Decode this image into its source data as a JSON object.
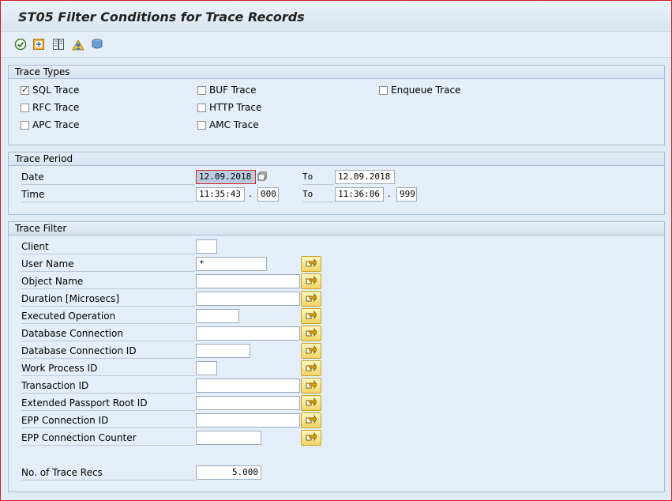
{
  "window": {
    "title": "ST05 Filter Conditions for Trace Records"
  },
  "toolbar": {
    "icons": [
      "execute-icon",
      "variant-icon",
      "list-icon",
      "users-icon",
      "database-icon"
    ]
  },
  "trace_types": {
    "header": "Trace Types",
    "items": [
      {
        "label": "SQL Trace",
        "checked": true
      },
      {
        "label": "BUF Trace",
        "checked": false
      },
      {
        "label": "Enqueue Trace",
        "checked": false
      },
      {
        "label": "RFC Trace",
        "checked": false
      },
      {
        "label": "HTTP Trace",
        "checked": false
      },
      {
        "label": "APC Trace",
        "checked": false
      },
      {
        "label": "AMC Trace",
        "checked": false
      }
    ]
  },
  "trace_period": {
    "header": "Trace Period",
    "date_label": "Date",
    "time_label": "Time",
    "to_label": "To",
    "date_from": "12.09.2018",
    "date_to": "12.09.2018",
    "time_from": "11:35:43",
    "time_from_ms": "000",
    "time_to": "11:36:06",
    "time_to_ms": "999",
    "separator": "."
  },
  "trace_filter": {
    "header": "Trace Filter",
    "fields": [
      {
        "label": "Client",
        "value": ""
      },
      {
        "label": "User Name",
        "value": "*"
      },
      {
        "label": "Object Name",
        "value": ""
      },
      {
        "label": "Duration [Microsecs]",
        "value": ""
      },
      {
        "label": "Executed Operation",
        "value": ""
      },
      {
        "label": "Database Connection",
        "value": ""
      },
      {
        "label": "Database Connection ID",
        "value": ""
      },
      {
        "label": "Work Process ID",
        "value": ""
      },
      {
        "label": "Transaction ID",
        "value": ""
      },
      {
        "label": "Extended Passport Root ID",
        "value": ""
      },
      {
        "label": "EPP Connection ID",
        "value": ""
      },
      {
        "label": "EPP Connection Counter",
        "value": ""
      }
    ],
    "num_recs_label": "No. of Trace Recs",
    "num_recs_value": "5.000"
  }
}
